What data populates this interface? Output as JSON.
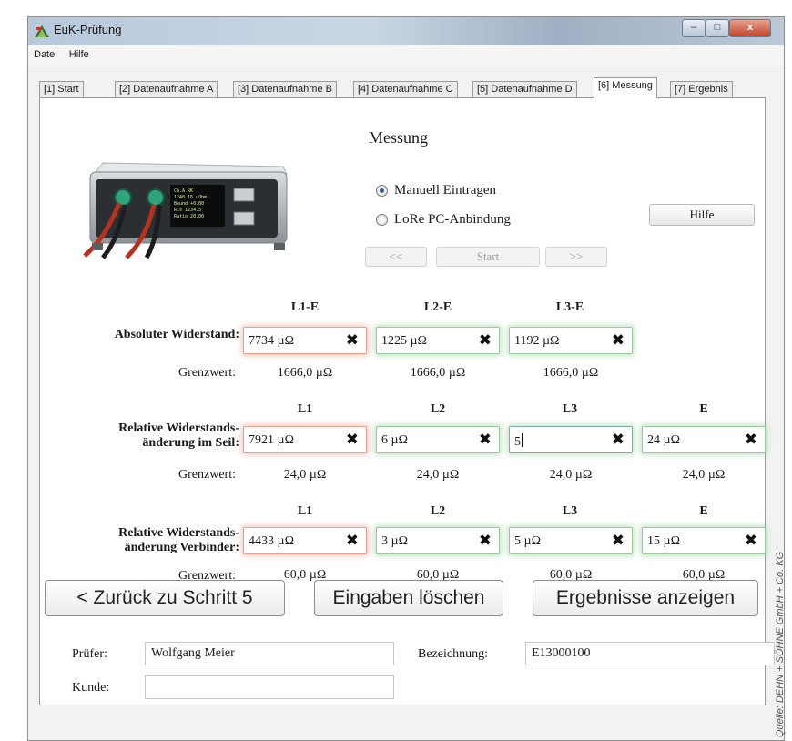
{
  "window": {
    "title": "EuK-Prüfung",
    "minimize": "–",
    "maximize": "□",
    "close": "x"
  },
  "menu": [
    "Datei",
    "Hilfe"
  ],
  "tabs": [
    "[1] Start",
    "[2] Datenaufnahme A",
    "[3] Datenaufnahme B",
    "[4] Datenaufnahme C",
    "[5] Datenaufnahme D",
    "[6] Messung",
    "[7] Ergebnis"
  ],
  "active_tab": "[6] Messung",
  "measurement": {
    "title": "Messung",
    "radio_manual": "Manuell Eintragen",
    "radio_pc": "LoRe PC-Anbindung",
    "selected": "Manuell Eintragen",
    "help_button": "Hilfe",
    "prev_button": "<<",
    "start_button": "Start",
    "next_button": ">>"
  },
  "absolute": {
    "label": "Absoluter Widerstand:",
    "headers": [
      "L1-E",
      "L2-E",
      "L3-E"
    ],
    "values": [
      "7734 µΩ",
      "1225 µΩ",
      "1192 µΩ"
    ],
    "grenz_label": "Grenzwert:",
    "limits": [
      "1666,0 µΩ",
      "1666,0 µΩ",
      "1666,0 µΩ"
    ]
  },
  "rel_seil": {
    "label_line1": "Relative Widerstands-",
    "label_line2": "änderung im Seil:",
    "headers": [
      "L1",
      "L2",
      "L3",
      "E"
    ],
    "values": [
      "7921 µΩ",
      "6 µΩ",
      "5",
      "24 µΩ"
    ],
    "grenz_label": "Grenzwert:",
    "limits": [
      "24,0 µΩ",
      "24,0 µΩ",
      "24,0 µΩ",
      "24,0 µΩ"
    ]
  },
  "rel_verbinder": {
    "label_line1": "Relative Widerstands-",
    "label_line2": "änderung Verbinder:",
    "headers": [
      "L1",
      "L2",
      "L3",
      "E"
    ],
    "values": [
      "4433 µΩ",
      "3 µΩ",
      "5 µΩ",
      "15 µΩ"
    ],
    "grenz_label": "Grenzwert:",
    "limits": [
      "60,0 µΩ",
      "60,0 µΩ",
      "60,0 µΩ",
      "60,0 µΩ"
    ]
  },
  "clear_glyph": "✖",
  "buttons": {
    "back": "< Zurück zu Schritt 5",
    "clear": "Eingaben löschen",
    "results": "Ergebnisse anzeigen"
  },
  "footer": {
    "pruefer_label": "Prüfer:",
    "pruefer_value": "Wolfgang Meier",
    "bezeichnung_label": "Bezeichnung:",
    "bezeichnung_value": "E13000100",
    "kunde_label": "Kunde:",
    "kunde_value": ""
  },
  "credit": "Quelle: DEHN + SÖHNE GmbH + Co. KG",
  "colors": {
    "invalid_glow": "#ec8c78",
    "valid_glow": "#82c882",
    "title_bar": "#b8c9dc"
  }
}
